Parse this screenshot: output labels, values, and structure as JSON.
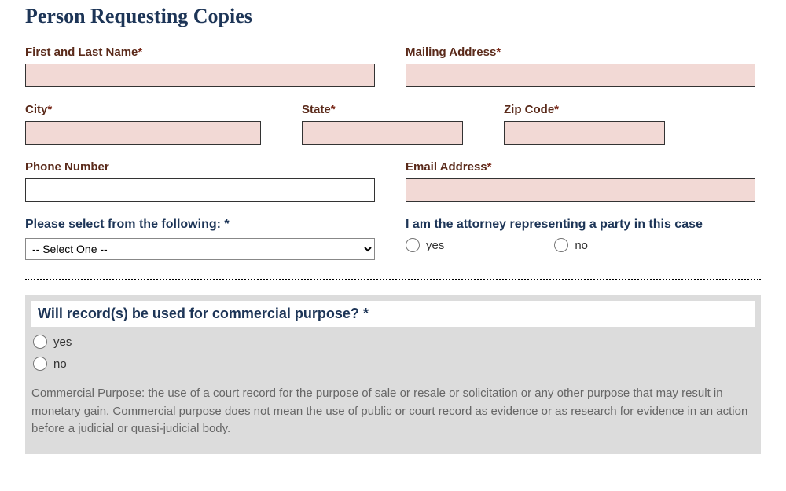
{
  "section": {
    "title": "Person Requesting Copies"
  },
  "fields": {
    "name": {
      "label": "First and Last Name",
      "required": true
    },
    "mailing": {
      "label": "Mailing Address",
      "required": true
    },
    "city": {
      "label": "City",
      "required": true
    },
    "state": {
      "label": "State",
      "required": true
    },
    "zip": {
      "label": "Zip Code",
      "required": true
    },
    "phone": {
      "label": "Phone Number",
      "required": false
    },
    "email": {
      "label": "Email Address",
      "required": true
    },
    "selectFollowing": {
      "label": "Please select from the following:",
      "required_mark": " *",
      "placeholder": "-- Select One --"
    },
    "attorney": {
      "label": "I am the attorney representing a party in this case",
      "yes": "yes",
      "no": "no"
    }
  },
  "commercial": {
    "question": "Will record(s) be used for commercial purpose?",
    "required_mark": " *",
    "yes": "yes",
    "no": "no",
    "disclaimer": "Commercial Purpose: the use of a court record for the purpose of sale or resale or solicitation or any other purpose that may result in monetary gain. Commercial purpose does not mean the use of public or court record as evidence or as research for evidence in an action before a judicial or quasi-judicial body."
  },
  "req_mark": "*"
}
